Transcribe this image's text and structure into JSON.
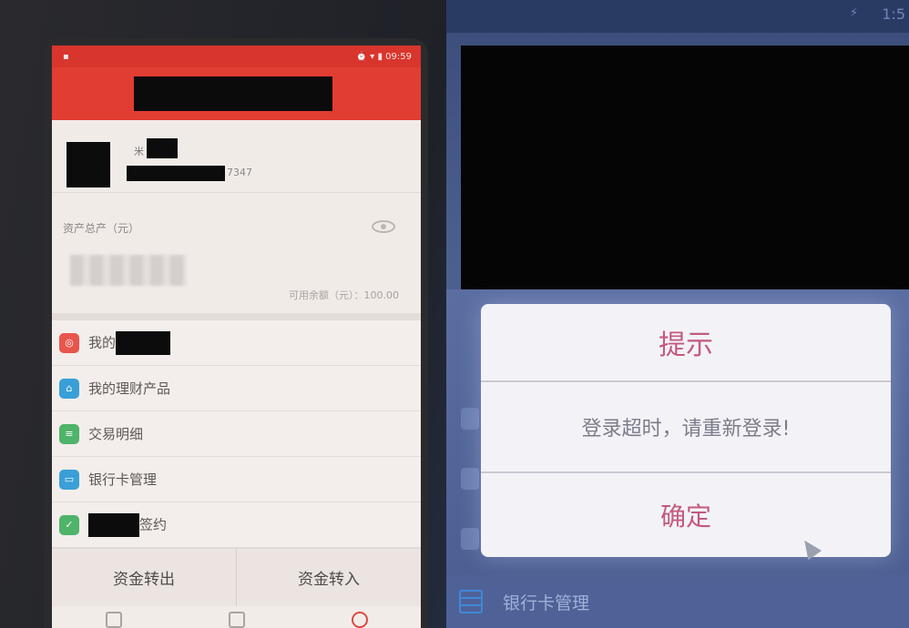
{
  "left_phone": {
    "status": {
      "left_icon": "▪",
      "right_text": "⏰ ▾ ▮ 09:59"
    },
    "profile": {
      "name_prefix": "米",
      "phone_suffix": "7347"
    },
    "assets": {
      "label": "资产总产（元）",
      "available": "可用余额（元）：100.00"
    },
    "menu": [
      {
        "icon": "record-icon",
        "color": "#e8554d",
        "glyph": "◎",
        "label": "我的",
        "redact_width": 60
      },
      {
        "icon": "wealth-icon",
        "color": "#3a9fd6",
        "glyph": "⌂",
        "label": "我的理财产品",
        "redact_width": 0
      },
      {
        "icon": "detail-icon",
        "color": "#4fb36a",
        "glyph": "≡",
        "label": "交易明细",
        "redact_width": 0
      },
      {
        "icon": "bank-card-icon",
        "color": "#3a9fd6",
        "glyph": "▭",
        "label": "银行卡管理",
        "redact_width": 0
      },
      {
        "icon": "sign-icon",
        "color": "#4fb36a",
        "glyph": "✓",
        "label": "签约",
        "redact_width": 56,
        "redact_before": true
      }
    ],
    "bottom_buttons": {
      "withdraw": "资金转出",
      "deposit": "资金转入"
    }
  },
  "right_phone": {
    "status_time": "1:5",
    "status_bolt": "⚡",
    "bank_row_label": "银行卡管理",
    "dialog": {
      "title": "提示",
      "message": "登录超时，请重新登录!",
      "confirm": "确定"
    }
  },
  "colors": {
    "header_red": "#e23d32",
    "dialog_accent": "#c45a7c"
  }
}
